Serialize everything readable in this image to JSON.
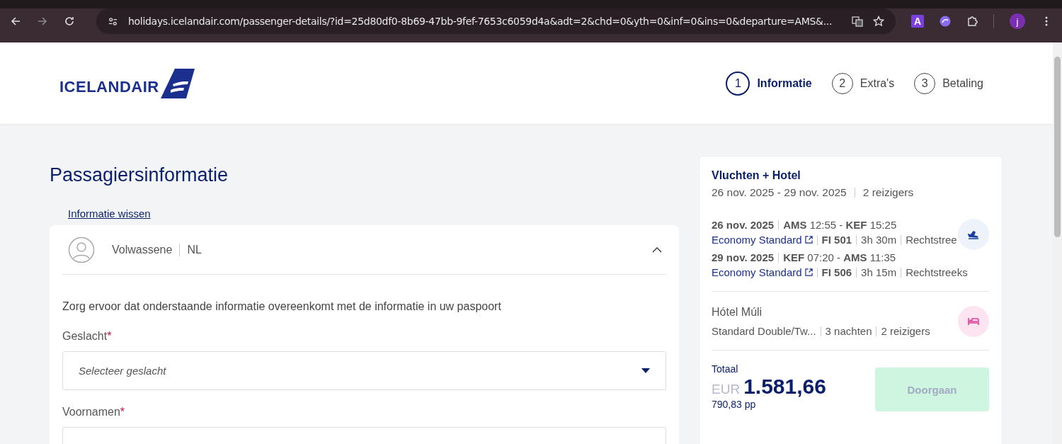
{
  "browser": {
    "url": "holidays.icelandair.com/passenger-details/?id=25d80df0-8b69-47bb-9fef-7653c6059d4a&adt=2&chd=0&yth=0&inf=0&ins=0&departure=AMS&...",
    "extension_letter": "A",
    "profile_initial": "j"
  },
  "header": {
    "logo_text": "ICELANDAIR",
    "steps": [
      {
        "number": "1",
        "label": "Informatie",
        "selected": true
      },
      {
        "number": "2",
        "label": "Extra's",
        "selected": false
      },
      {
        "number": "3",
        "label": "Betaling",
        "selected": false
      }
    ]
  },
  "form": {
    "title": "Passagiersinformatie",
    "clear_link": "Informatie wissen",
    "passenger": {
      "type": "Volwassene",
      "nationality": "NL",
      "expanded": true
    },
    "notice": "Zorg ervoor dat onderstaande informatie overeenkomt met de informatie in uw paspoort",
    "fields": [
      {
        "kind": "select",
        "label": "Geslacht",
        "required_mark": "*",
        "placeholder": "Selecteer geslacht"
      },
      {
        "kind": "text",
        "label": "Voornamen",
        "required_mark": "*"
      }
    ]
  },
  "summary": {
    "title": "Vluchten + Hotel",
    "dates": "26 nov. 2025 - 29 nov. 2025",
    "travellers": "2 reizigers",
    "flights": [
      {
        "date": "26 nov. 2025",
        "route": "**AMS** 12:55 - **KEF** 15:25",
        "fare": "Economy Standard",
        "flight_number": "FI 501",
        "duration": "3h 30m",
        "type": "Rechtstree"
      },
      {
        "date": "29 nov. 2025",
        "route": "**KEF** 07:20 - **AMS** 11:35",
        "fare": "Economy Standard",
        "flight_number": "FI 506",
        "duration": "3h 15m",
        "type": "Rechtstreeks"
      }
    ],
    "hotel": {
      "name": "Hótel Múli",
      "room": "Standard Double/Tw...",
      "nights": "3 nachten",
      "travellers": "2 reizigers"
    },
    "total": {
      "label": "Totaal",
      "currency": "EUR",
      "amount": "1.581,66",
      "per_person": "790,83 pp"
    },
    "continue_button": {
      "label": "Doorgaan",
      "disabled": true
    }
  }
}
